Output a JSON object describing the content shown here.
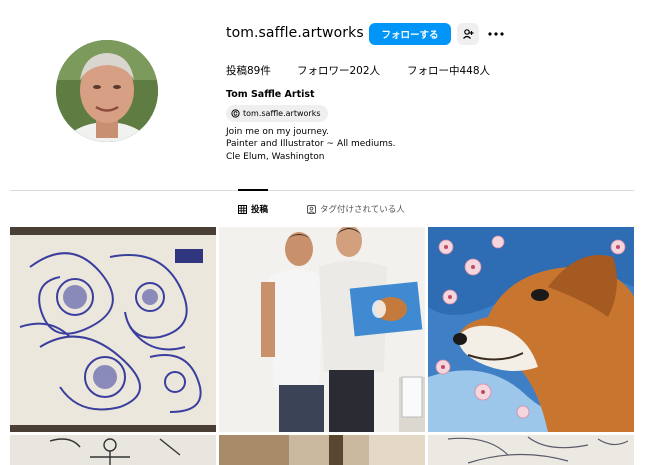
{
  "profile": {
    "username": "tom.saffle.artworks",
    "full_name": "Tom Saffle Artist",
    "threads_handle": "tom.saffle.artworks",
    "bio_lines": [
      "Join me on my journey.",
      "Painter and Illustrator ~ All mediums.",
      "Cle Elum, Washington"
    ]
  },
  "actions": {
    "follow_label": "フォローする"
  },
  "stats": {
    "posts": "投稿89件",
    "followers": "フォロワー202人",
    "following": "フォロー中448人"
  },
  "tabs": [
    {
      "label": "投稿",
      "icon": "grid-icon",
      "active": true
    },
    {
      "label": "タグ付けされている人",
      "icon": "tag-icon",
      "active": false
    }
  ],
  "colors": {
    "accent": "#0095f6",
    "divider": "#dbdbdb"
  }
}
